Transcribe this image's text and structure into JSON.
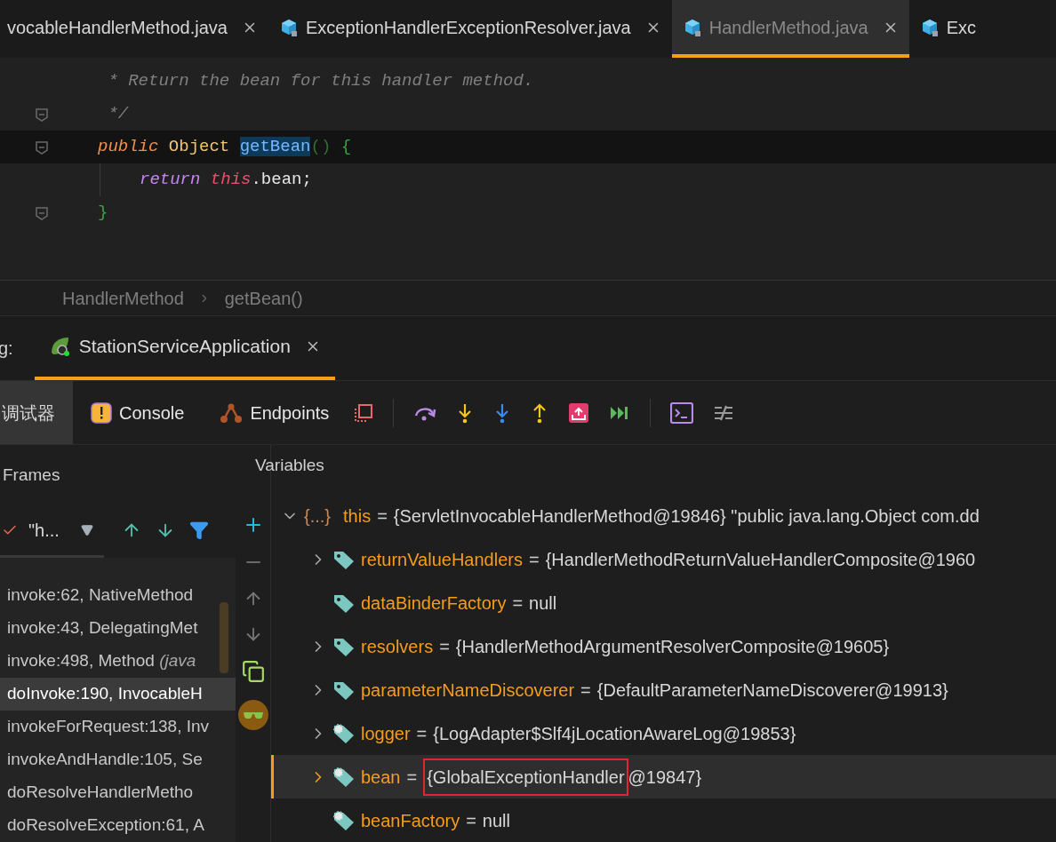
{
  "editor_tabs": [
    {
      "label": "vocableHandlerMethod.java",
      "selected": false
    },
    {
      "label": "ExceptionHandlerExceptionResolver.java",
      "selected": false
    },
    {
      "label": "HandlerMethod.java",
      "selected": true
    },
    {
      "label": "Exc",
      "selected": false
    }
  ],
  "code_lines": [
    {
      "current": false,
      "fold": false,
      "indented": false,
      "tokens": [
        {
          "kind": "comment",
          "text": " * Return the bean for this handler method."
        }
      ]
    },
    {
      "current": false,
      "fold": true,
      "indented": false,
      "tokens": [
        {
          "kind": "comment",
          "text": " */"
        }
      ]
    },
    {
      "current": true,
      "fold": true,
      "indented": false,
      "tokens": [
        {
          "kind": "keyword",
          "text": "public "
        },
        {
          "kind": "type",
          "text": "Object "
        },
        {
          "kind": "selection",
          "text": "getBean"
        },
        {
          "kind": "paren",
          "text": "() "
        },
        {
          "kind": "brace",
          "text": "{"
        }
      ]
    },
    {
      "current": false,
      "fold": false,
      "indented": true,
      "tokens": [
        {
          "kind": "control",
          "text": "return "
        },
        {
          "kind": "this",
          "text": "this"
        },
        {
          "kind": "plain",
          "text": ".bean;"
        }
      ]
    },
    {
      "current": false,
      "fold": true,
      "indented": false,
      "tokens": [
        {
          "kind": "brace",
          "text": "}"
        }
      ]
    }
  ],
  "breadcrumb": [
    "HandlerMethod",
    "getBean()"
  ],
  "debug_label": "g:",
  "run_tabs": [
    {
      "label": "StationServiceApplication",
      "selected": true
    }
  ],
  "debugger_tabs": [
    {
      "label": "调试器",
      "selected": true
    },
    {
      "label": "Console",
      "selected": false
    },
    {
      "label": "Endpoints",
      "selected": false
    }
  ],
  "frames": {
    "title": "Frames",
    "thread": "\"h...",
    "rows": [
      {
        "method": "invoke:62, NativeMethod",
        "selected": false
      },
      {
        "method": "invoke:43, DelegatingMet",
        "selected": false
      },
      {
        "method": "invoke:498, Method ",
        "package": "(java",
        "selected": false
      },
      {
        "method": "doInvoke:190, InvocableH",
        "selected": true
      },
      {
        "method": "invokeForRequest:138, Inv",
        "selected": false
      },
      {
        "method": "invokeAndHandle:105, Se",
        "selected": false
      },
      {
        "method": "doResolveHandlerMetho",
        "selected": false
      },
      {
        "method": "doResolveException:61, A",
        "selected": false
      }
    ]
  },
  "variables": {
    "title": "Variables",
    "rows": [
      {
        "kind": "object",
        "prefix": "{...}",
        "name": "this",
        "separator": "=",
        "expandable": true,
        "expanded": true,
        "selected": false,
        "value": "{ServletInvocableHandlerMethod@19846} \"public java.lang.Object com.dd"
      },
      {
        "kind": "field",
        "name": "returnValueHandlers",
        "separator": "=",
        "expandable": true,
        "expanded": false,
        "selected": false,
        "value": "{HandlerMethodReturnValueHandlerComposite@1960"
      },
      {
        "kind": "field",
        "name": "dataBinderFactory",
        "separator": "=",
        "expandable": false,
        "selected": false,
        "value": "null"
      },
      {
        "kind": "field",
        "name": "resolvers",
        "separator": "=",
        "expandable": true,
        "expanded": false,
        "selected": false,
        "value": "{HandlerMethodArgumentResolverComposite@19605}"
      },
      {
        "kind": "field",
        "name": "parameterNameDiscoverer",
        "separator": "=",
        "expandable": true,
        "expanded": false,
        "selected": false,
        "value": "{DefaultParameterNameDiscoverer@19913}"
      },
      {
        "kind": "final_field",
        "name": "logger",
        "separator": "=",
        "expandable": true,
        "expanded": false,
        "selected": false,
        "value": "{LogAdapter$Slf4jLocationAwareLog@19853}"
      },
      {
        "kind": "final_field",
        "name": "bean",
        "separator": "=",
        "expandable": true,
        "expanded": false,
        "selected": true,
        "boxed": "{GlobalExceptionHandler",
        "value": "@19847}"
      },
      {
        "kind": "final_field",
        "name": "beanFactory",
        "separator": "=",
        "expandable": false,
        "selected": false,
        "value": "null"
      }
    ]
  }
}
